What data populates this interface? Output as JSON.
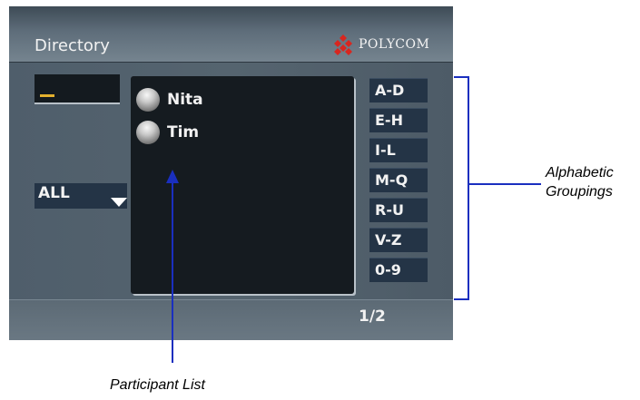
{
  "header": {
    "title": "Directory",
    "logo_text": "POLYCOM"
  },
  "filter": {
    "selected": "ALL"
  },
  "participants": [
    {
      "name": "Nita"
    },
    {
      "name": "Tim"
    }
  ],
  "groups": [
    "A-D",
    "E-H",
    "I-L",
    "M-Q",
    "R-U",
    "V-Z",
    "0-9"
  ],
  "footer": {
    "page_indicator": "1/2"
  },
  "annotations": {
    "groupings_line1": "Alphabetic",
    "groupings_line2": "Groupings",
    "participant_list": "Participant List"
  },
  "colors": {
    "annotation_line": "#1a2fbf",
    "logo_red": "#d8261f",
    "entry_cursor": "#e3b02e"
  },
  "icons": {
    "logo": "polycom-logo-icon",
    "dropdown": "triangle-down-icon",
    "participant": "participant-ball-icon"
  }
}
